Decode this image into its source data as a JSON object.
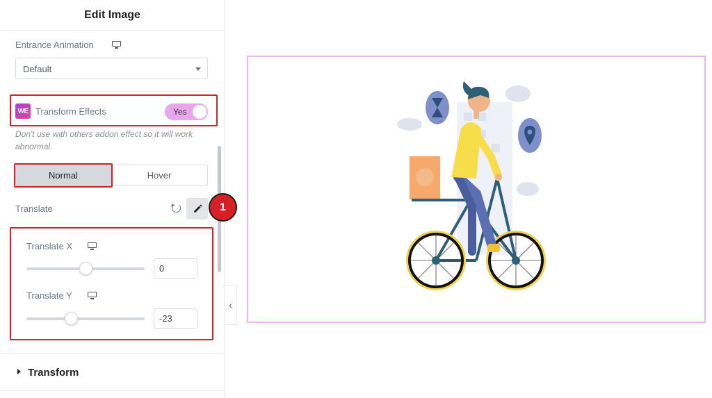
{
  "sidebar": {
    "title": "Edit Image",
    "entrance_animation": {
      "label": "Entrance Animation",
      "value": "Default"
    },
    "transform_effects": {
      "label": "Transform Effects",
      "logo_text": "WE",
      "toggle_label": "Yes",
      "enabled": true
    },
    "note": "Don't use with others addon effect so it will work abnormal.",
    "tabs": {
      "normal": "Normal",
      "hover": "Hover",
      "active": "normal"
    },
    "translate": {
      "label": "Translate"
    },
    "annotation_badge": "1",
    "popover": {
      "translate_x": {
        "label": "Translate X",
        "value": "0",
        "slider_fraction": 0.5
      },
      "translate_y": {
        "label": "Translate Y",
        "value": "-23",
        "slider_fraction": 0.38
      }
    },
    "transform_section": {
      "label": "Transform"
    },
    "collapse_icon": "‹"
  },
  "colors": {
    "highlight": "#d0252d",
    "toggle_on": "#e8a7ec",
    "canvas_border": "#efb4f2",
    "badge": "#d61f26"
  },
  "canvas": {
    "image": "delivery-cyclist-illustration"
  }
}
